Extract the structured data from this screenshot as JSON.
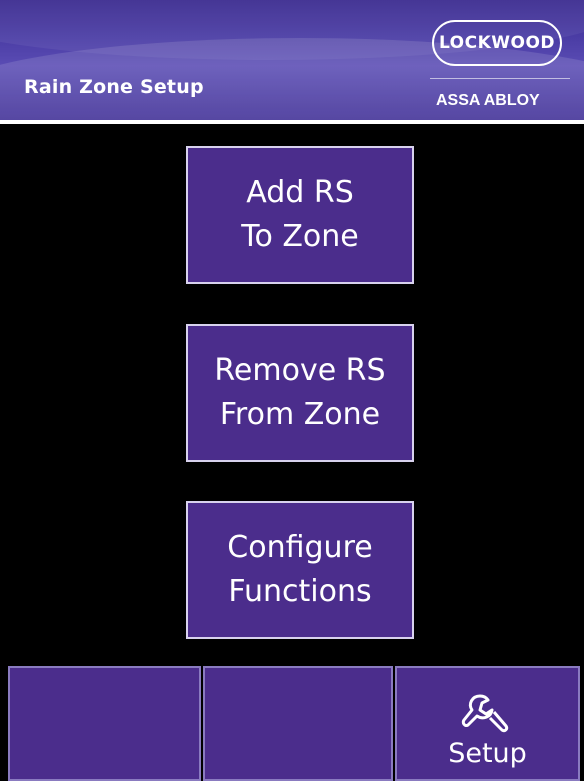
{
  "header": {
    "title": "Rain Zone Setup",
    "logo_text": "LOCKWOOD",
    "brand": "ASSA ABLOY"
  },
  "menu": {
    "add_label": "Add RS\nTo Zone",
    "remove_label": "Remove RS\nFrom Zone",
    "configure_label": "Configure\nFunctions"
  },
  "bottom_bar": {
    "button1_label": "",
    "button2_label": "",
    "setup_label": "Setup",
    "setup_icon": "wrench-icon"
  },
  "colors": {
    "button_fill": "#4b2d8c",
    "header_fill": "#4a3ca4",
    "background": "#000000",
    "text": "#ffffff"
  }
}
